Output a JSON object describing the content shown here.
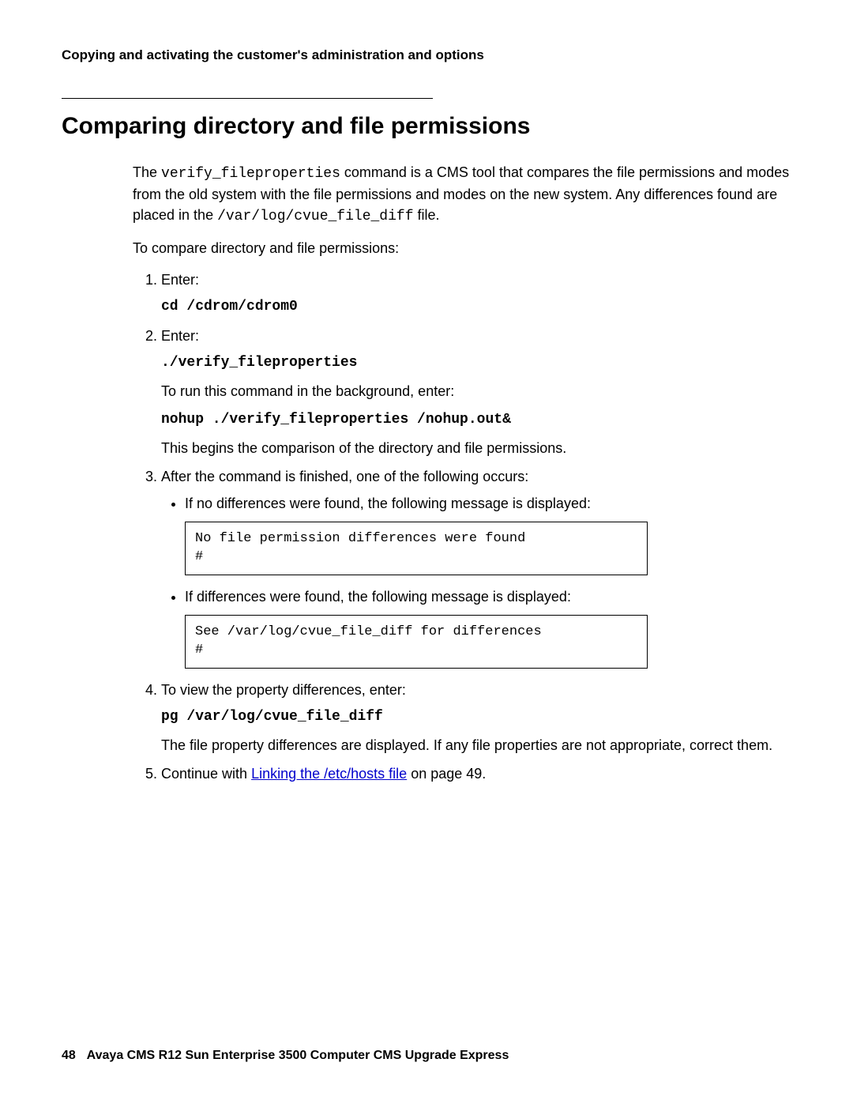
{
  "header": {
    "running_title": "Copying and activating the customer's administration and options"
  },
  "section": {
    "title": "Comparing directory and file permissions",
    "intro_parts": {
      "p1a": "The ",
      "p1_cmd1": "verify_fileproperties",
      "p1b": " command is a CMS tool that compares the file permissions and modes from the old system with the file permissions and modes on the new system. Any differences found are placed in the ",
      "p1_cmd2": "/var/log/cvue_file_diff",
      "p1c": " file."
    },
    "lead_in": "To compare directory and file permissions:"
  },
  "steps": {
    "s1": {
      "text": "Enter:",
      "cmd": "cd /cdrom/cdrom0"
    },
    "s2": {
      "text": "Enter:",
      "cmd1": "./verify_fileproperties",
      "note1": "To run this command in the background, enter:",
      "cmd2": "nohup ./verify_fileproperties /nohup.out&",
      "note2": "This begins the comparison of the directory and file permissions."
    },
    "s3": {
      "text": "After the command is finished, one of the following occurs:",
      "bullet1": "If no differences were found, the following message is displayed:",
      "output1": "No file permission differences were found\n#",
      "bullet2": "If differences were found, the following message is displayed:",
      "output2": "See /var/log/cvue_file_diff for differences\n#"
    },
    "s4": {
      "text": "To view the property differences, enter:",
      "cmd": "pg /var/log/cvue_file_diff",
      "note": "The file property differences are displayed. If any file properties are not appropriate, correct them."
    },
    "s5": {
      "pre": "Continue with ",
      "link": "Linking the /etc/hosts file",
      "post": " on page 49."
    }
  },
  "footer": {
    "page_number": "48",
    "doc_title": "Avaya CMS R12 Sun Enterprise 3500 Computer CMS Upgrade Express"
  }
}
